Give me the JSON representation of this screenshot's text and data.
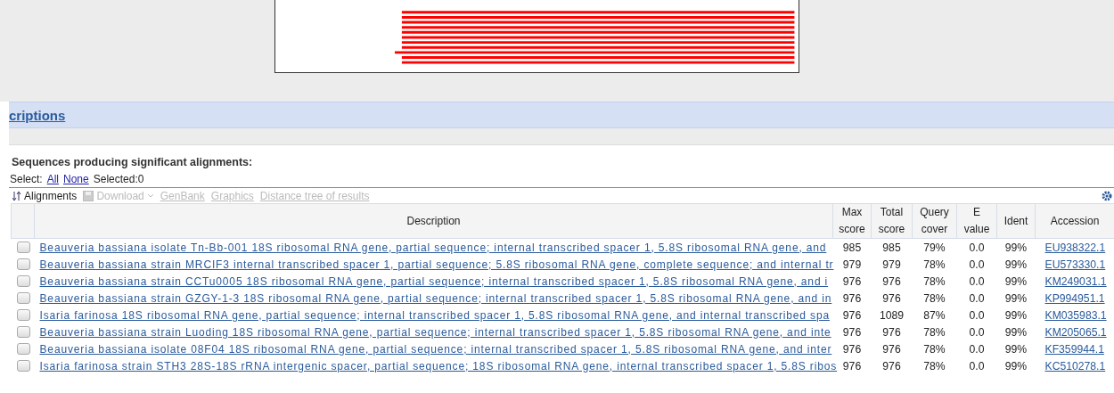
{
  "section_link": "criptions",
  "heading": "Sequences producing significant alignments:",
  "select": {
    "label": "Select:",
    "all": "All",
    "none": "None",
    "selected": "Selected:0"
  },
  "toolbar": [
    {
      "kind": "sort",
      "label": "Alignments",
      "disabled": false
    },
    {
      "kind": "download",
      "label": "Download",
      "disabled": true
    },
    {
      "kind": "link",
      "label": "GenBank",
      "disabled": true
    },
    {
      "kind": "link",
      "label": "Graphics",
      "disabled": true
    },
    {
      "kind": "link",
      "label": "Distance tree of results",
      "disabled": true
    }
  ],
  "table": {
    "columns": [
      "Description",
      "Max score",
      "Total score",
      "Query cover",
      "E value",
      "Ident",
      "Accession"
    ],
    "rows": [
      {
        "checked": false,
        "description": "Beauveria bassiana isolate Tn-Bb-001 18S ribosomal RNA gene, partial sequence; internal transcribed spacer 1, 5.8S ribosomal RNA gene, and",
        "max_score": "985",
        "total_score": "985",
        "query_cover": "79%",
        "e_value": "0.0",
        "ident": "99%",
        "accession": "EU938322.1"
      },
      {
        "checked": false,
        "description": "Beauveria bassiana strain MRCIF3 internal transcribed spacer 1, partial sequence; 5.8S ribosomal RNA gene, complete sequence; and internal tr",
        "max_score": "979",
        "total_score": "979",
        "query_cover": "78%",
        "e_value": "0.0",
        "ident": "99%",
        "accession": "EU573330.1"
      },
      {
        "checked": false,
        "description": "Beauveria bassiana strain CCTu0005 18S ribosomal RNA gene, partial sequence; internal transcribed spacer 1, 5.8S ribosomal RNA gene, and i",
        "max_score": "976",
        "total_score": "976",
        "query_cover": "78%",
        "e_value": "0.0",
        "ident": "99%",
        "accession": "KM249031.1"
      },
      {
        "checked": false,
        "description": "Beauveria bassiana strain GZGY-1-3 18S ribosomal RNA gene, partial sequence; internal transcribed spacer 1, 5.8S ribosomal RNA gene, and in",
        "max_score": "976",
        "total_score": "976",
        "query_cover": "78%",
        "e_value": "0.0",
        "ident": "99%",
        "accession": "KP994951.1"
      },
      {
        "checked": false,
        "description": "Isaria farinosa 18S ribosomal RNA gene, partial sequence; internal transcribed spacer 1, 5.8S ribosomal RNA gene, and internal transcribed spa",
        "max_score": "976",
        "total_score": "1089",
        "query_cover": "87%",
        "e_value": "0.0",
        "ident": "99%",
        "accession": "KM035983.1"
      },
      {
        "checked": false,
        "description": "Beauveria bassiana strain Luoding 18S ribosomal RNA gene, partial sequence; internal transcribed spacer 1, 5.8S ribosomal RNA gene, and inte",
        "max_score": "976",
        "total_score": "976",
        "query_cover": "78%",
        "e_value": "0.0",
        "ident": "99%",
        "accession": "KM205065.1"
      },
      {
        "checked": false,
        "description": "Beauveria bassiana isolate 08F04 18S ribosomal RNA gene, partial sequence; internal transcribed spacer 1, 5.8S ribosomal RNA gene, and inter",
        "max_score": "976",
        "total_score": "976",
        "query_cover": "78%",
        "e_value": "0.0",
        "ident": "99%",
        "accession": "KF359944.1"
      },
      {
        "checked": false,
        "description": "Isaria farinosa strain STH3 28S-18S rRNA intergenic spacer, partial sequence; 18S ribosomal RNA gene, internal transcribed spacer 1, 5.8S ribos",
        "max_score": "976",
        "total_score": "976",
        "query_cover": "78%",
        "e_value": "0.0",
        "ident": "99%",
        "accession": "KC510278.1"
      }
    ]
  }
}
